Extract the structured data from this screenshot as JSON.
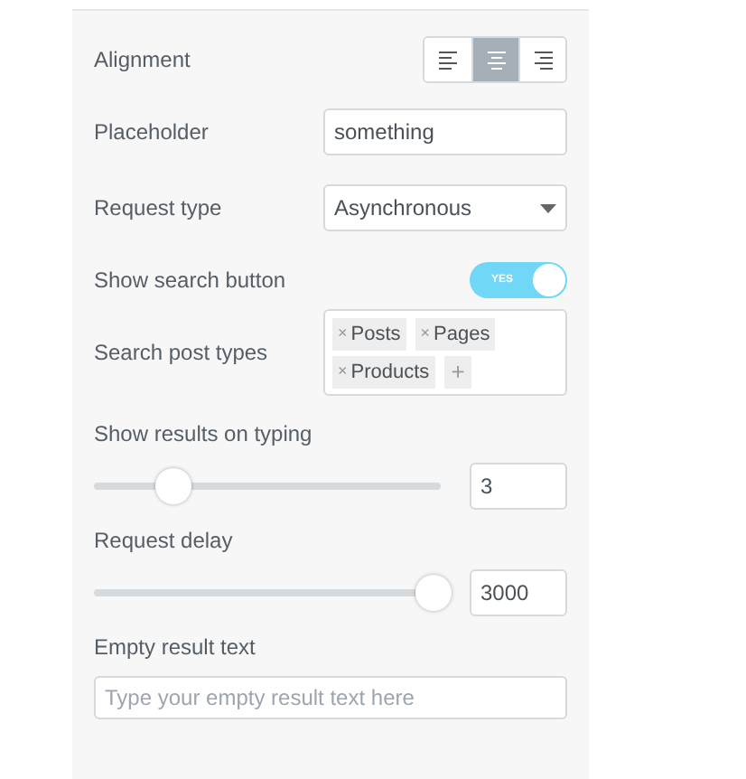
{
  "controls": [
    {
      "kind": "alignment",
      "label": "Alignment",
      "options": [
        {
          "kind": "left",
          "selected": false
        },
        {
          "kind": "center",
          "selected": true
        },
        {
          "kind": "right",
          "selected": false
        }
      ]
    },
    {
      "kind": "text",
      "label": "Placeholder",
      "value": "something"
    },
    {
      "kind": "select",
      "label": "Request type",
      "value": "Asynchronous"
    },
    {
      "kind": "switch",
      "label": "Show search button",
      "on": true,
      "text": "YES"
    },
    {
      "kind": "tags",
      "label": "Search post types",
      "tags": [
        "Posts",
        "Pages",
        "Products"
      ],
      "remove": "×",
      "add": "+"
    },
    {
      "kind": "slider",
      "label": "Show results on typing",
      "level": 0.22,
      "value": "3"
    },
    {
      "kind": "slider",
      "label": "Request delay",
      "level": 1,
      "value": "3000"
    },
    {
      "kind": "textarea",
      "label": "Empty result text",
      "placeholder": "Type your empty result text here"
    }
  ]
}
